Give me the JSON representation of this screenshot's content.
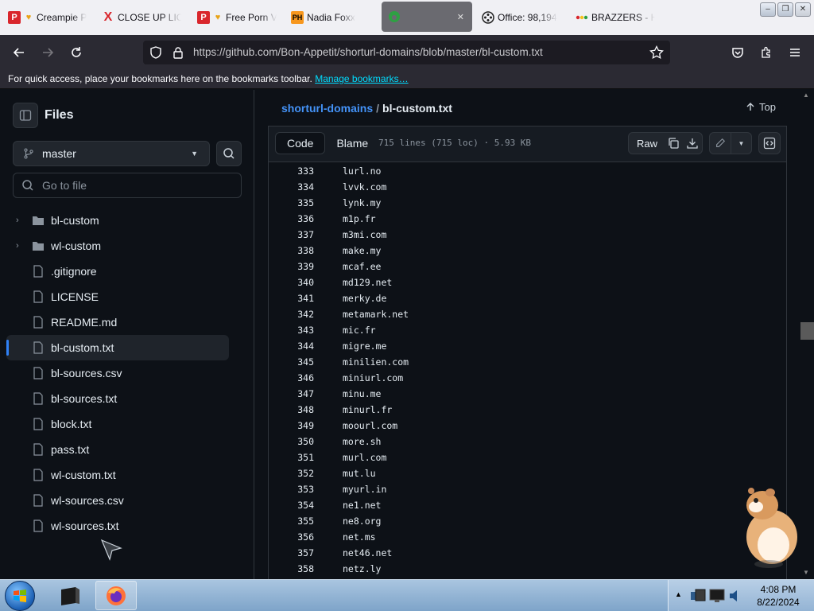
{
  "browser": {
    "tabs": [
      {
        "label": "Creampie P",
        "icon": "heart-ribbon-icon",
        "icon_color": "#e8a317"
      },
      {
        "label": "CLOSE UP LIC",
        "icon": "x-logo-icon",
        "icon_color": "#d9262c"
      },
      {
        "label": "Free Porn V",
        "icon": "p-logo-icon",
        "icon_color": "#d9262c"
      },
      {
        "label": "Nadia Foxx",
        "icon": "ph-logo-icon",
        "icon_color": "#f7971d"
      },
      {
        "label": "",
        "icon": "github-icon",
        "icon_color": "#2ea043",
        "active": true
      },
      {
        "label": "Office: 98,194",
        "icon": "film-reel-icon",
        "icon_color": "#222222"
      },
      {
        "label": "BRAZZERS - H",
        "icon": "dots-icon",
        "icon_color": "#d9262c"
      }
    ],
    "url": "https://github.com/Bon-Appetit/shorturl-domains/blob/master/bl-custom.txt",
    "bookmarks": {
      "text": "For quick access, place your bookmarks here on the bookmarks toolbar.",
      "link": "Manage bookmarks…"
    }
  },
  "sidebar": {
    "title": "Files",
    "branch": "master",
    "goto_placeholder": "Go to file",
    "items": [
      {
        "name": "bl-custom",
        "type": "folder"
      },
      {
        "name": "wl-custom",
        "type": "folder"
      },
      {
        "name": ".gitignore",
        "type": "file"
      },
      {
        "name": "LICENSE",
        "type": "file"
      },
      {
        "name": "README.md",
        "type": "file"
      },
      {
        "name": "bl-custom.txt",
        "type": "file",
        "selected": true
      },
      {
        "name": "bl-sources.csv",
        "type": "file"
      },
      {
        "name": "bl-sources.txt",
        "type": "file"
      },
      {
        "name": "block.txt",
        "type": "file"
      },
      {
        "name": "pass.txt",
        "type": "file"
      },
      {
        "name": "wl-custom.txt",
        "type": "file"
      },
      {
        "name": "wl-sources.csv",
        "type": "file"
      },
      {
        "name": "wl-sources.txt",
        "type": "file"
      }
    ]
  },
  "main": {
    "breadcrumb": {
      "repo": "shorturl-domains",
      "sep": "/",
      "file": "bl-custom.txt"
    },
    "top_label": "Top",
    "tabs": {
      "code": "Code",
      "blame": "Blame"
    },
    "meta": "715 lines (715 loc) · 5.93 KB",
    "raw_label": "Raw",
    "lines": [
      {
        "n": "333",
        "t": "lurl.no"
      },
      {
        "n": "334",
        "t": "lvvk.com"
      },
      {
        "n": "335",
        "t": "lynk.my"
      },
      {
        "n": "336",
        "t": "m1p.fr"
      },
      {
        "n": "337",
        "t": "m3mi.com"
      },
      {
        "n": "338",
        "t": "make.my"
      },
      {
        "n": "339",
        "t": "mcaf.ee"
      },
      {
        "n": "340",
        "t": "md129.net"
      },
      {
        "n": "341",
        "t": "merky.de"
      },
      {
        "n": "342",
        "t": "metamark.net"
      },
      {
        "n": "343",
        "t": "mic.fr"
      },
      {
        "n": "344",
        "t": "migre.me"
      },
      {
        "n": "345",
        "t": "minilien.com"
      },
      {
        "n": "346",
        "t": "miniurl.com"
      },
      {
        "n": "347",
        "t": "minu.me"
      },
      {
        "n": "348",
        "t": "minurl.fr"
      },
      {
        "n": "349",
        "t": "moourl.com"
      },
      {
        "n": "350",
        "t": "more.sh"
      },
      {
        "n": "351",
        "t": "murl.com"
      },
      {
        "n": "352",
        "t": "mut.lu"
      },
      {
        "n": "353",
        "t": "myurl.in"
      },
      {
        "n": "354",
        "t": "ne1.net"
      },
      {
        "n": "355",
        "t": "ne8.org"
      },
      {
        "n": "356",
        "t": "net.ms"
      },
      {
        "n": "357",
        "t": "net46.net"
      },
      {
        "n": "358",
        "t": "netz.ly"
      }
    ]
  },
  "taskbar": {
    "time": "4:08 PM",
    "date": "8/22/2024"
  },
  "colors": {
    "accent_link": "#4493f8",
    "bg": "#0d1117",
    "border": "#30363d"
  }
}
